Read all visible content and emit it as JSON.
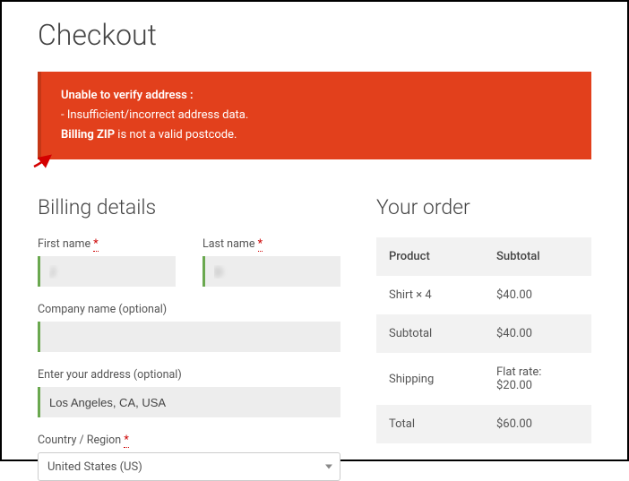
{
  "page": {
    "title": "Checkout"
  },
  "alert": {
    "line1": "Unable to verify address :",
    "line2": "- Insufficient/incorrect address data.",
    "line3_bold": "Billing ZIP",
    "line3_rest": " is not a valid postcode."
  },
  "billing": {
    "heading": "Billing details",
    "first_name_label": "First name",
    "first_name_value": "J",
    "last_name_label": "Last name",
    "last_name_value": "D",
    "company_label": "Company name (optional)",
    "company_value": "",
    "address_label": "Enter your address (optional)",
    "address_value": "Los Angeles, CA, USA",
    "country_label": "Country / Region",
    "country_value": "United States (US)",
    "required_mark": "*"
  },
  "order": {
    "heading": "Your order",
    "header_product": "Product",
    "header_subtotal": "Subtotal",
    "items": [
      {
        "name": "Shirt  × 4",
        "subtotal": "$40.00"
      }
    ],
    "subtotal_label": "Subtotal",
    "subtotal_value": "$40.00",
    "shipping_label": "Shipping",
    "shipping_value": "Flat rate: $20.00",
    "total_label": "Total",
    "total_value": "$60.00"
  }
}
